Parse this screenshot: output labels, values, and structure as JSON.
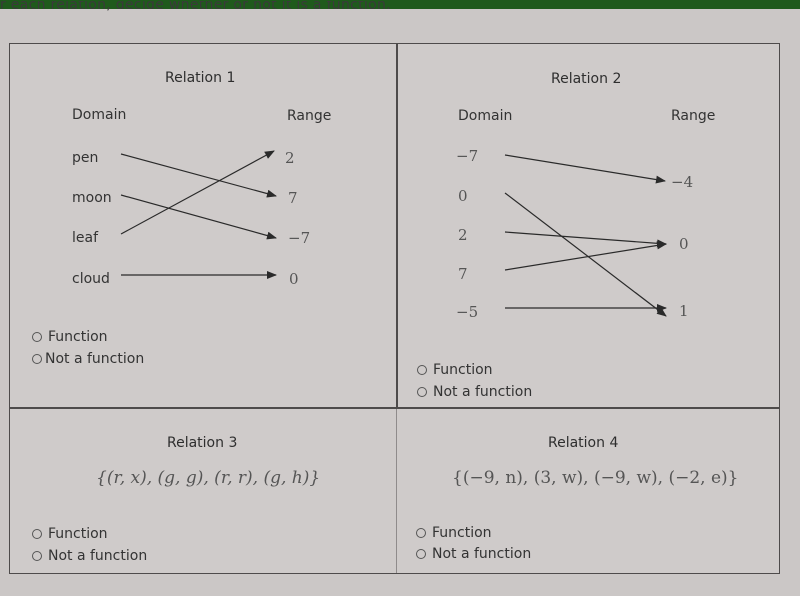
{
  "header": {
    "instruction": "r each relation, decide whether or not it is a function."
  },
  "relations": [
    {
      "title": "Relation 1",
      "type": "mapping",
      "domain_label": "Domain",
      "range_label": "Range",
      "domain": [
        "pen",
        "moon",
        "leaf",
        "cloud"
      ],
      "range": [
        "2",
        "7",
        "−7",
        "0"
      ],
      "mappings": [
        [
          "pen",
          "7"
        ],
        [
          "moon",
          "−7"
        ],
        [
          "leaf",
          "2"
        ],
        [
          "cloud",
          "0"
        ]
      ],
      "options": [
        "Function",
        "Not a function"
      ]
    },
    {
      "title": "Relation 2",
      "type": "mapping",
      "domain_label": "Domain",
      "range_label": "Range",
      "domain": [
        "−7",
        "0",
        "2",
        "7",
        "−5"
      ],
      "range": [
        "−4",
        "0",
        "1"
      ],
      "mappings": [
        [
          "−7",
          "−4"
        ],
        [
          "0",
          "1"
        ],
        [
          "2",
          "0"
        ],
        [
          "7",
          "0"
        ],
        [
          "−5",
          "1"
        ]
      ],
      "options": [
        "Function",
        "Not a function"
      ]
    },
    {
      "title": "Relation 3",
      "type": "set",
      "set_text": "{(r, x), (g, g), (r, r), (g, h)}",
      "options": [
        "Function",
        "Not a function"
      ]
    },
    {
      "title": "Relation 4",
      "type": "set",
      "set_text": "{(−9, n), (3, w), (−9, w), (−2, e)}",
      "options": [
        "Function",
        "Not a function"
      ]
    }
  ],
  "colors": {
    "header_bar": "#1f5a1c",
    "background": "#cbc7c6",
    "border": "#4e4b4b"
  }
}
